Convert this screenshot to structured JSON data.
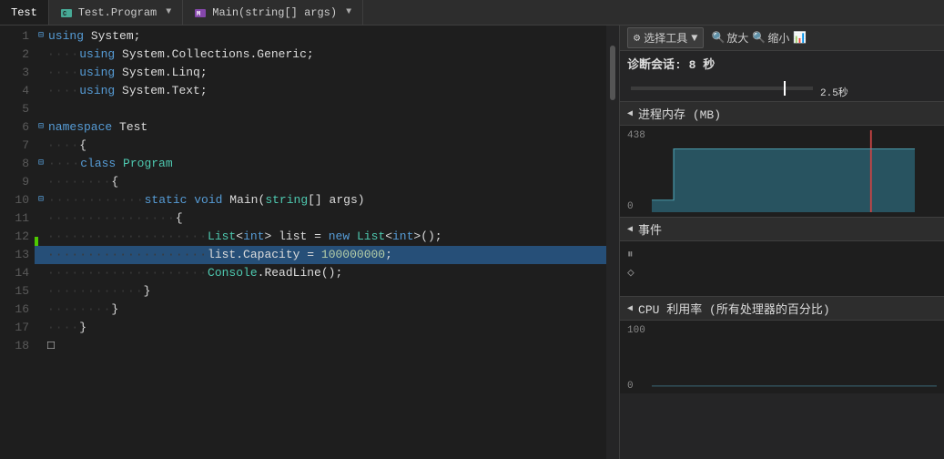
{
  "tabs": [
    {
      "id": "test",
      "label": "Test",
      "icon": "file",
      "active": true,
      "dropdown": true
    },
    {
      "id": "test-program",
      "label": "Test.Program",
      "icon": "class",
      "active": false,
      "dropdown": true
    },
    {
      "id": "main-args",
      "label": "Main(string[] args)",
      "icon": "method",
      "active": false,
      "dropdown": true
    }
  ],
  "code": {
    "lines": [
      {
        "num": 1,
        "indent": 0,
        "collapse": "minus",
        "content": "using_system"
      },
      {
        "num": 2,
        "indent": 1,
        "content": "using_generic"
      },
      {
        "num": 3,
        "indent": 1,
        "content": "using_linq"
      },
      {
        "num": 4,
        "indent": 1,
        "content": "using_text"
      },
      {
        "num": 5,
        "indent": 0,
        "content": "empty"
      },
      {
        "num": 6,
        "indent": 0,
        "collapse": "minus",
        "content": "namespace_test"
      },
      {
        "num": 7,
        "indent": 1,
        "content": "open_brace"
      },
      {
        "num": 8,
        "indent": 1,
        "collapse": "minus",
        "content": "class_program"
      },
      {
        "num": 9,
        "indent": 2,
        "content": "open_brace2"
      },
      {
        "num": 10,
        "indent": 2,
        "collapse": "minus",
        "content": "static_main"
      },
      {
        "num": 11,
        "indent": 3,
        "content": "open_brace3"
      },
      {
        "num": 12,
        "indent": 3,
        "content": "list_init"
      },
      {
        "num": 13,
        "indent": 3,
        "content": "list_capacity",
        "highlighted": true
      },
      {
        "num": 14,
        "indent": 3,
        "content": "console_readline"
      },
      {
        "num": 15,
        "indent": 3,
        "content": "close_brace3"
      },
      {
        "num": 16,
        "indent": 2,
        "content": "close_brace2"
      },
      {
        "num": 17,
        "indent": 1,
        "content": "close_brace1"
      },
      {
        "num": 18,
        "indent": 0,
        "content": "empty2"
      }
    ]
  },
  "diagnostics": {
    "toolbar": {
      "select_tool_label": "选择工具",
      "zoom_in_label": "放大",
      "zoom_out_label": "缩小",
      "chart_icon": "📊"
    },
    "session_label": "诊断会话: 8 秒",
    "time_marker": "2.5秒",
    "sections": [
      {
        "id": "memory",
        "label": "进程内存 (MB)",
        "collapsed": false,
        "y_max": "438",
        "y_min": "0"
      },
      {
        "id": "events",
        "label": "事件",
        "collapsed": false
      },
      {
        "id": "cpu",
        "label": "CPU 利用率 (所有处理器的百分比)",
        "collapsed": false,
        "y_max": "100",
        "y_min": "0"
      }
    ]
  }
}
